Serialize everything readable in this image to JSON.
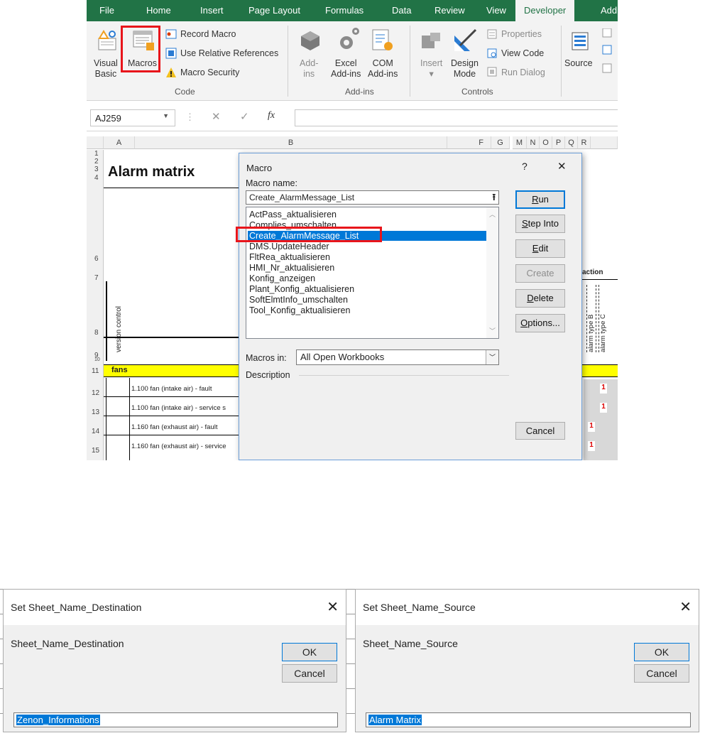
{
  "excel": {
    "tabs": [
      "File",
      "Home",
      "Insert",
      "Page Layout",
      "Formulas",
      "Data",
      "Review",
      "View",
      "Developer",
      "Add"
    ],
    "active_tab": "Developer",
    "ribbon": {
      "visual_basic": [
        "Visual",
        "Basic"
      ],
      "macros": "Macros",
      "record_macro": "Record Macro",
      "use_relative": "Use Relative References",
      "macro_security": "Macro Security",
      "group_code": "Code",
      "addins": [
        "Add-",
        "ins"
      ],
      "excel_addins": [
        "Excel",
        "Add-ins"
      ],
      "com_addins": [
        "COM",
        "Add-ins"
      ],
      "group_addins": "Add-ins",
      "insert": "Insert",
      "design_mode": [
        "Design",
        "Mode"
      ],
      "properties": "Properties",
      "view_code": "View Code",
      "run_dialog": "Run Dialog",
      "group_controls": "Controls",
      "source": "Source"
    },
    "name_box": "AJ259",
    "fx_symbol": "fx",
    "columns": [
      "A",
      "B",
      "F",
      "G",
      "M",
      "N",
      "O",
      "P",
      "Q",
      "R"
    ],
    "rows": [
      "1",
      "2",
      "3",
      "4",
      "6",
      "7",
      "8",
      "9",
      "10",
      "11",
      "12",
      "13",
      "14",
      "15"
    ],
    "sheet_title": "Alarm matrix",
    "version_control_label": "version control",
    "fans_label": "fans",
    "row_texts": [
      "1.100 fan (intake air) - fault",
      "1.100 fan (intake air) - service s",
      "1.160 fan (exhaust air) - fault",
      "1.160 fan (exhaust air) - service"
    ],
    "action_label": "action",
    "alarm_type_b": "alarm type B",
    "alarm_type_c": "alarm type C",
    "cell_value": "1"
  },
  "macro_dialog": {
    "title": "Macro",
    "help": "?",
    "close": "✕",
    "macro_name_label": "Macro name:",
    "macro_name_value": "Create_AlarmMessage_List",
    "list": [
      "ActPass_aktualisieren",
      "Complies_umschalten",
      "Create_AlarmMessage_List",
      "DMS.UpdateHeader",
      "FltRea_aktualisieren",
      "HMI_Nr_aktualisieren",
      "Konfig_anzeigen",
      "Plant_Konfig_aktualisieren",
      "SoftElmtInfo_umschalten",
      "Tool_Konfig_aktualisieren"
    ],
    "selected_index": 2,
    "buttons": {
      "run": "Run",
      "step_into": "Step Into",
      "edit": "Edit",
      "create": "Create",
      "delete": "Delete",
      "options": "Options...",
      "cancel": "Cancel"
    },
    "macros_in_label": "Macros in:",
    "macros_in_value": "All Open Workbooks",
    "description_label": "Description"
  },
  "dest_dialog": {
    "title": "Set Sheet_Name_Destination",
    "prompt": "Sheet_Name_Destination",
    "ok": "OK",
    "cancel": "Cancel",
    "value": "Zenon_Informations"
  },
  "src_dialog": {
    "title": "Set Sheet_Name_Source",
    "prompt": "Sheet_Name_Source",
    "ok": "OK",
    "cancel": "Cancel",
    "value": "Alarm Matrix"
  },
  "colors": {
    "excel_green": "#217346",
    "highlight_red": "#e8151b",
    "selection_blue": "#0078d7",
    "fans_yellow": "#ffff00"
  }
}
